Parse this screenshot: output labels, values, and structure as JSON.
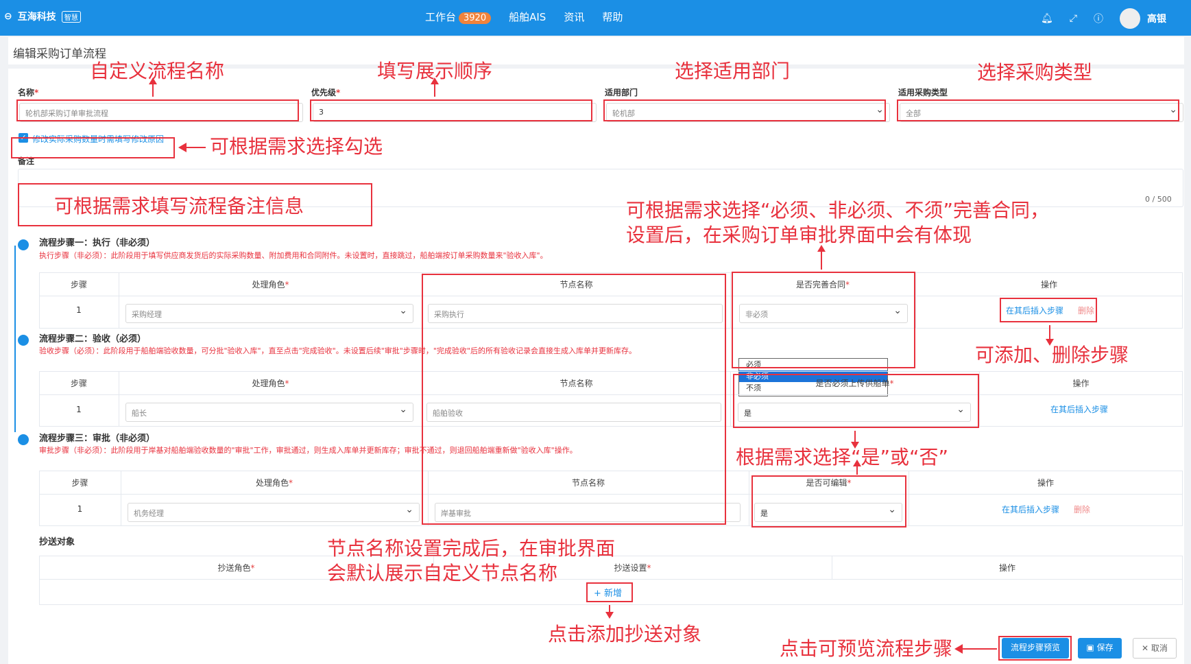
{
  "topbar": {
    "brand": "互海科技",
    "brand_tag": "智慧",
    "nav": [
      {
        "label": "工作台",
        "badge": "3920"
      },
      {
        "label": "船舶AIS"
      },
      {
        "label": "资讯"
      },
      {
        "label": "帮助"
      }
    ],
    "user_name": "高银"
  },
  "page": {
    "title": "编辑采购订单流程"
  },
  "form": {
    "name_label": "名称",
    "name_value": "轮机部采购订单审批流程",
    "priority_label": "优先级",
    "priority_value": "3",
    "dept_label": "适用部门",
    "dept_value": "轮机部",
    "type_label": "适用采购类型",
    "type_value": "全部",
    "checkbox_label": "修改实际采购数量时需填写修改原因",
    "remarks_label": "备注",
    "remarks_counter": "0 / 500"
  },
  "steps": [
    {
      "title": "流程步骤一：执行（非必须）",
      "desc": "执行步骤（非必须）：此阶段用于填写供应商发货后的实际采购数量、附加费用和合同附件。未设置时，直接跳过，船舶端按订单采购数量来\"验收入库\"。",
      "headers": [
        "步骤",
        "处理角色",
        "节点名称",
        "是否完善合同",
        "操作"
      ],
      "row": {
        "step": "1",
        "role": "采购经理",
        "node": "采购执行",
        "option": "非必须"
      },
      "actions": [
        "在其后插入步骤",
        "删除"
      ]
    },
    {
      "title": "流程步骤二：验收（必须）",
      "desc": "验收步骤（必须）：此阶段用于船舶端验收数量，可分批\"验收入库\"，直至点击\"完成验收\"。未设置后续\"审批\"步骤时，\"完成验收\"后的所有验收记录会直接生成入库单并更新库存。",
      "headers": [
        "步骤",
        "处理角色",
        "节点名称",
        "是否必须上传供船单",
        "操作"
      ],
      "row": {
        "step": "1",
        "role": "船长",
        "node": "船舶验收",
        "option": "是"
      },
      "actions": [
        "在其后插入步骤"
      ]
    },
    {
      "title": "流程步骤三：审批（非必须）",
      "desc": "审批步骤（非必须）：此阶段用于岸基对船舶端验收数量的\"审批\"工作，审批通过，则生成入库单并更新库存；审批不通过，则退回船舶端重新做\"验收入库\"操作。",
      "headers": [
        "步骤",
        "处理角色",
        "节点名称",
        "是否可编辑",
        "操作"
      ],
      "row": {
        "step": "1",
        "role": "机务经理",
        "node": "岸基审批",
        "option": "是"
      },
      "actions": [
        "在其后插入步骤",
        "删除"
      ]
    }
  ],
  "dropdown_options": [
    "必须",
    "非必须",
    "不须"
  ],
  "cc": {
    "title": "抄送对象",
    "headers": [
      "抄送角色",
      "抄送设置",
      "操作"
    ],
    "add_label": "+ 新增"
  },
  "buttons": {
    "preview": "流程步骤预览",
    "save": "保存",
    "cancel": "取消"
  },
  "annotations": {
    "a1": "自定义流程名称",
    "a2": "填写展示顺序",
    "a3": "选择适用部门",
    "a4": "选择采购类型",
    "a5": "可根据需求选择勾选",
    "a6": "可根据需求填写流程备注信息",
    "a7_line1": "可根据需求选择“必须、非必须、不须”完善合同，",
    "a7_line2": "设置后，在采购订单审批界面中会有体现",
    "a8": "可添加、删除步骤",
    "a9": "根据需求选择“是”或“否”",
    "a10_line1": "节点名称设置完成后，在审批界面",
    "a10_line2": "会默认展示自定义节点名称",
    "a11": "点击添加抄送对象",
    "a12": "点击可预览流程步骤"
  },
  "colors": {
    "primary": "#1b8fe5",
    "annotation": "#e8313d",
    "badge": "#f0833c"
  }
}
